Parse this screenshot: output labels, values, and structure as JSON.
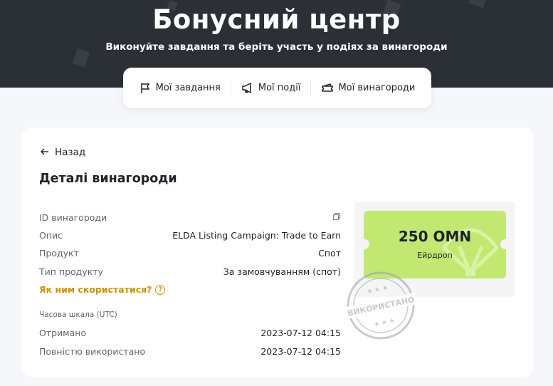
{
  "header": {
    "title": "Бонусний центр",
    "subtitle": "Виконуйте завдання та беріть участь у подіях за винагороди"
  },
  "tabs": [
    {
      "label": "Мої завдання",
      "icon": "flag-icon"
    },
    {
      "label": "Мої події",
      "icon": "megaphone-icon"
    },
    {
      "label": "Мої винагороди",
      "icon": "ticket-icon"
    }
  ],
  "details": {
    "back_label": "Назад",
    "title": "Деталі винагороди",
    "rows": [
      {
        "label": "ID винагороди",
        "value": ""
      },
      {
        "label": "Опис",
        "value": "ELDA Listing Campaign: Trade to Earn"
      },
      {
        "label": "Продукт",
        "value": "Спот"
      },
      {
        "label": "Тип продукту",
        "value": "За замовчуванням (спот)"
      }
    ],
    "howto_label": "Як ним скористатися?",
    "howto_icon": "?",
    "timescale_label": "Часова шкала (UTC)",
    "time_rows": [
      {
        "label": "Отримано",
        "value": "2023-07-12 04:15"
      },
      {
        "label": "Повністю використано",
        "value": "2023-07-12 04:15"
      }
    ]
  },
  "voucher": {
    "amount": "250 OMN",
    "type": "Ейрдроп",
    "stamp_text": "ВИКОРИСТАНО",
    "stamp_stars": "★ ★ ★",
    "color": "#c3e872"
  },
  "colors": {
    "header_bg": "#2b2f36",
    "accent": "#c99400",
    "page_bg": "#f5f7fa"
  }
}
